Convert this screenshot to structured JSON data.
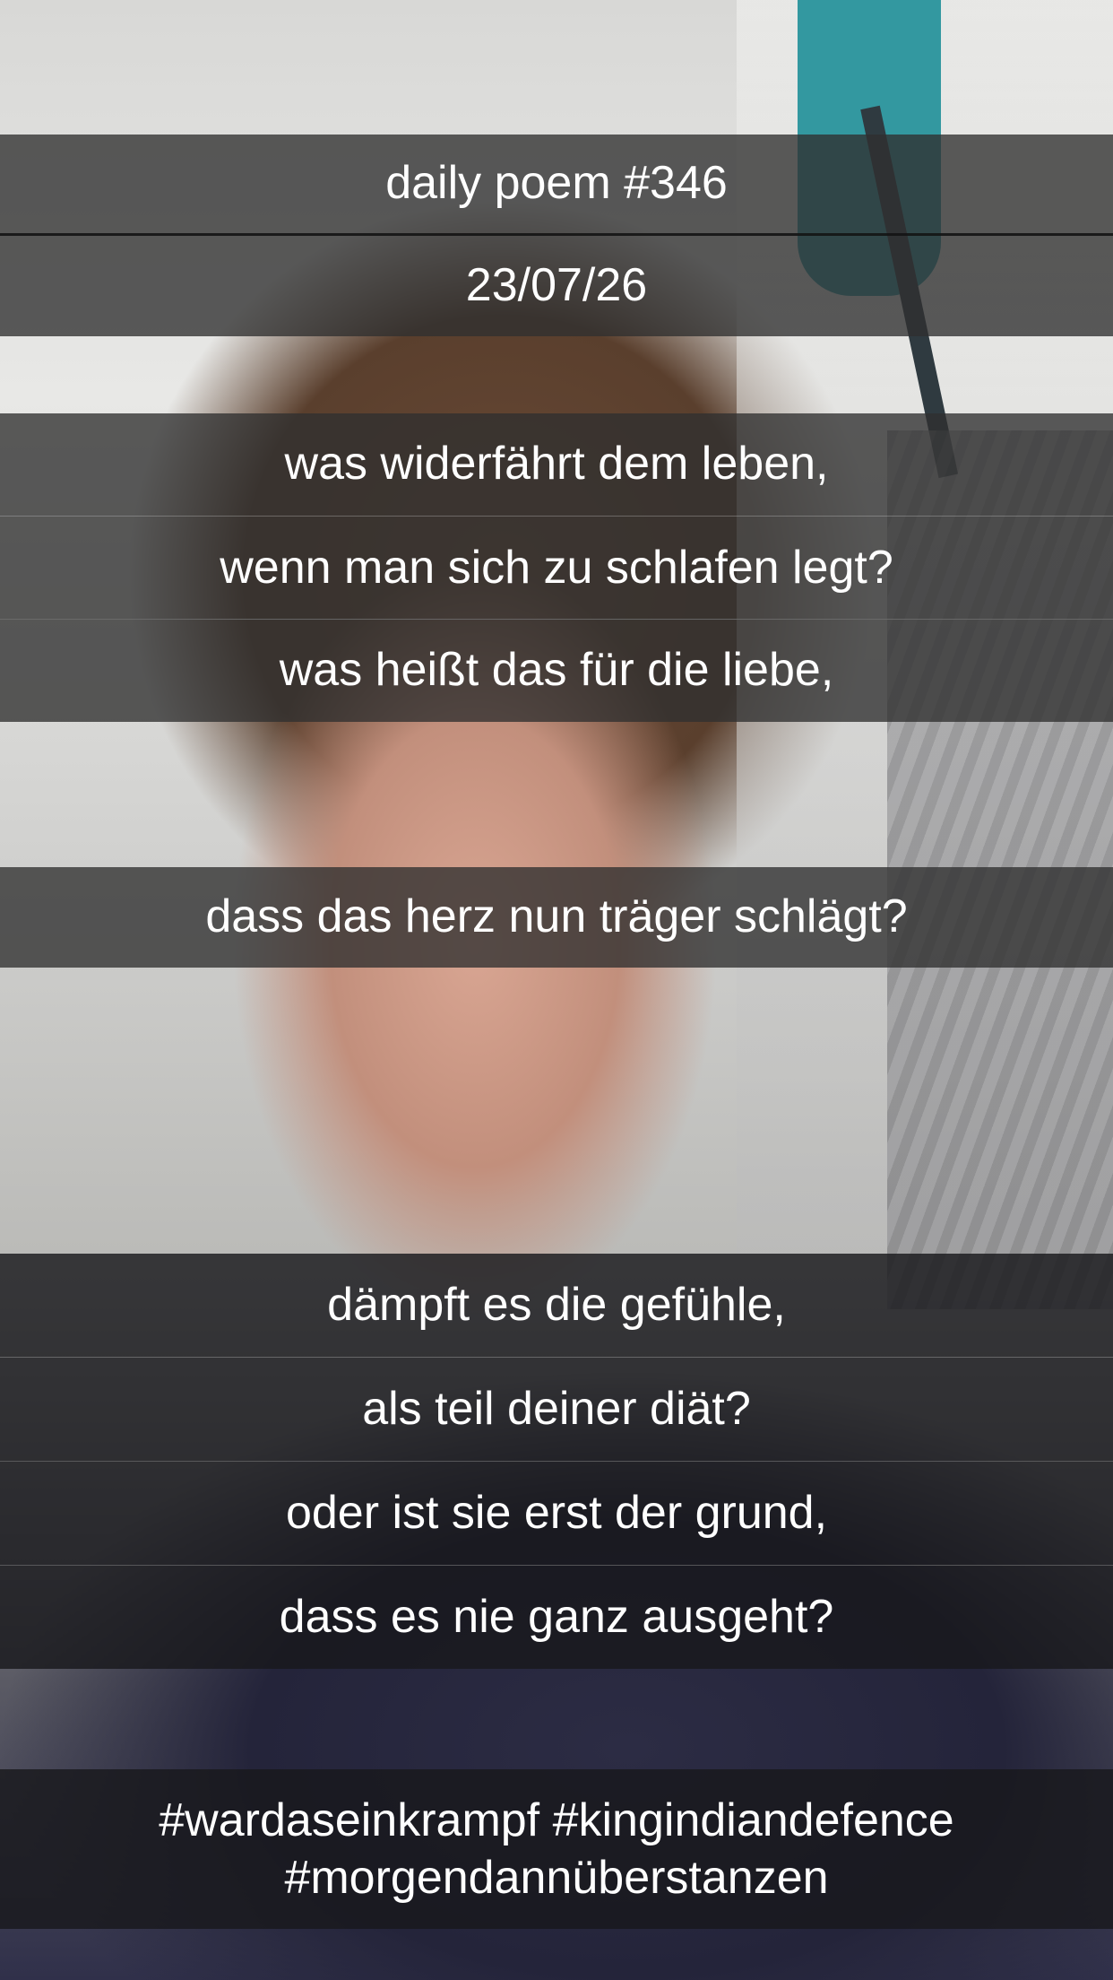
{
  "header": {
    "title": "daily poem #346",
    "date": "23/07/26"
  },
  "poem": {
    "stanza1": [
      "was widerfährt dem leben,",
      "wenn man sich zu schlafen legt?",
      "was heißt das für die liebe,"
    ],
    "stanza1_last": "dass das herz nun träger schlägt?",
    "stanza2": [
      "dämpft es die gefühle,",
      "als teil deiner diät?",
      "oder ist sie erst der grund,",
      "dass es nie ganz ausgeht?"
    ]
  },
  "hashtags": {
    "line1": "#wardaseinkrampf #kingindiandefence",
    "line2": "#morgendannüberstanzen"
  }
}
